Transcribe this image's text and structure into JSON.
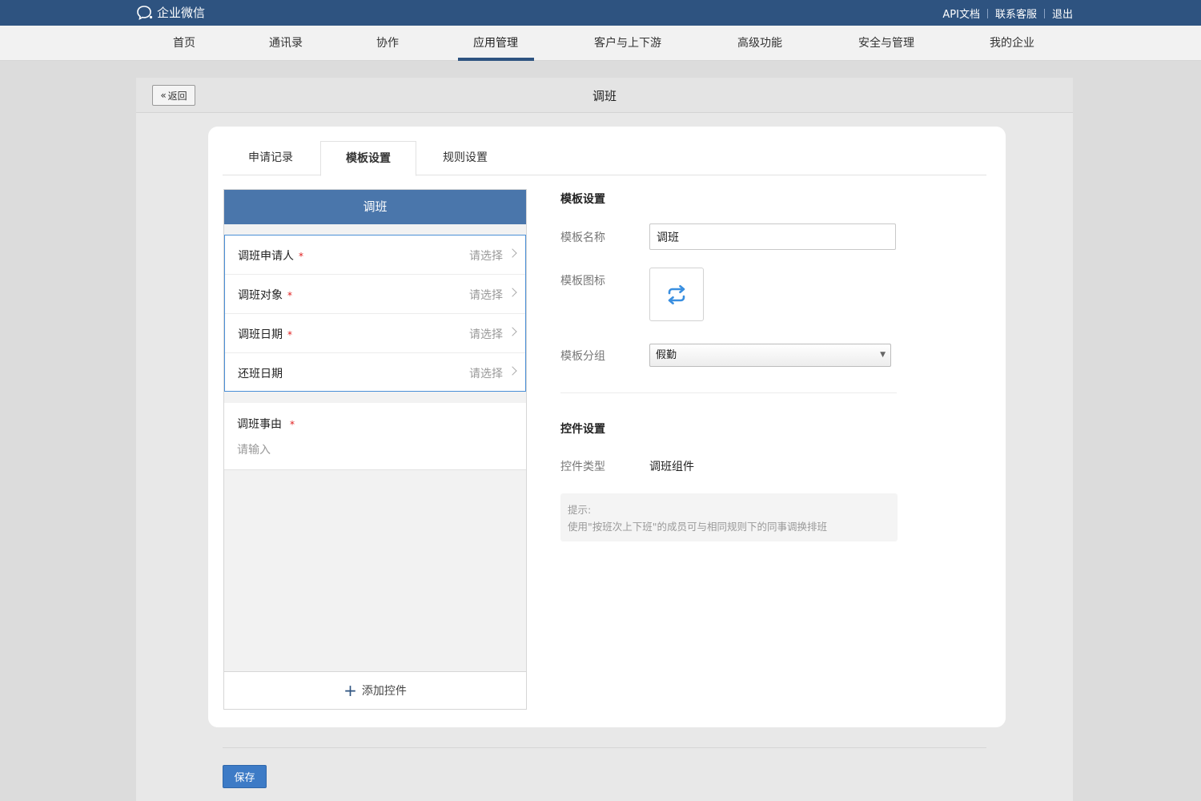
{
  "topbar": {
    "brand": "企业微信",
    "links": [
      "API文档",
      "联系客服",
      "退出"
    ]
  },
  "nav": {
    "items": [
      "首页",
      "通讯录",
      "协作",
      "应用管理",
      "客户与上下游",
      "高级功能",
      "安全与管理",
      "我的企业"
    ],
    "active_index": 3
  },
  "page": {
    "back_label": "返回",
    "title": "调班"
  },
  "tabs": {
    "items": [
      "申请记录",
      "模板设置",
      "规则设置"
    ],
    "active_index": 1
  },
  "preview": {
    "header": "调班",
    "fields": [
      {
        "label": "调班申请人",
        "required": true,
        "placeholder": "请选择"
      },
      {
        "label": "调班对象",
        "required": true,
        "placeholder": "请选择"
      },
      {
        "label": "调班日期",
        "required": true,
        "placeholder": "请选择"
      },
      {
        "label": "还班日期",
        "required": false,
        "placeholder": "请选择"
      }
    ],
    "reason": {
      "label": "调班事由",
      "required": true,
      "placeholder": "请输入"
    },
    "required_mark": "*",
    "add_control_label": "添加控件"
  },
  "template_settings": {
    "title": "模板设置",
    "name_label": "模板名称",
    "name_value": "调班",
    "icon_label": "模板图标",
    "icon_name": "swap-arrows-icon",
    "group_label": "模板分组",
    "group_value": "假勤"
  },
  "control_settings": {
    "title": "控件设置",
    "type_label": "控件类型",
    "type_value": "调班组件",
    "tip_title": "提示:",
    "tip_text": "使用\"按班次上下班\"的成员可与相同规则下的同事调换排班"
  },
  "footer": {
    "save_label": "保存"
  },
  "colors": {
    "topbar": "#2e5380",
    "preview_header": "#4a76ab",
    "save_button": "#3d7bc6",
    "required": "#e02020",
    "icon_blue": "#3a8fe0"
  }
}
